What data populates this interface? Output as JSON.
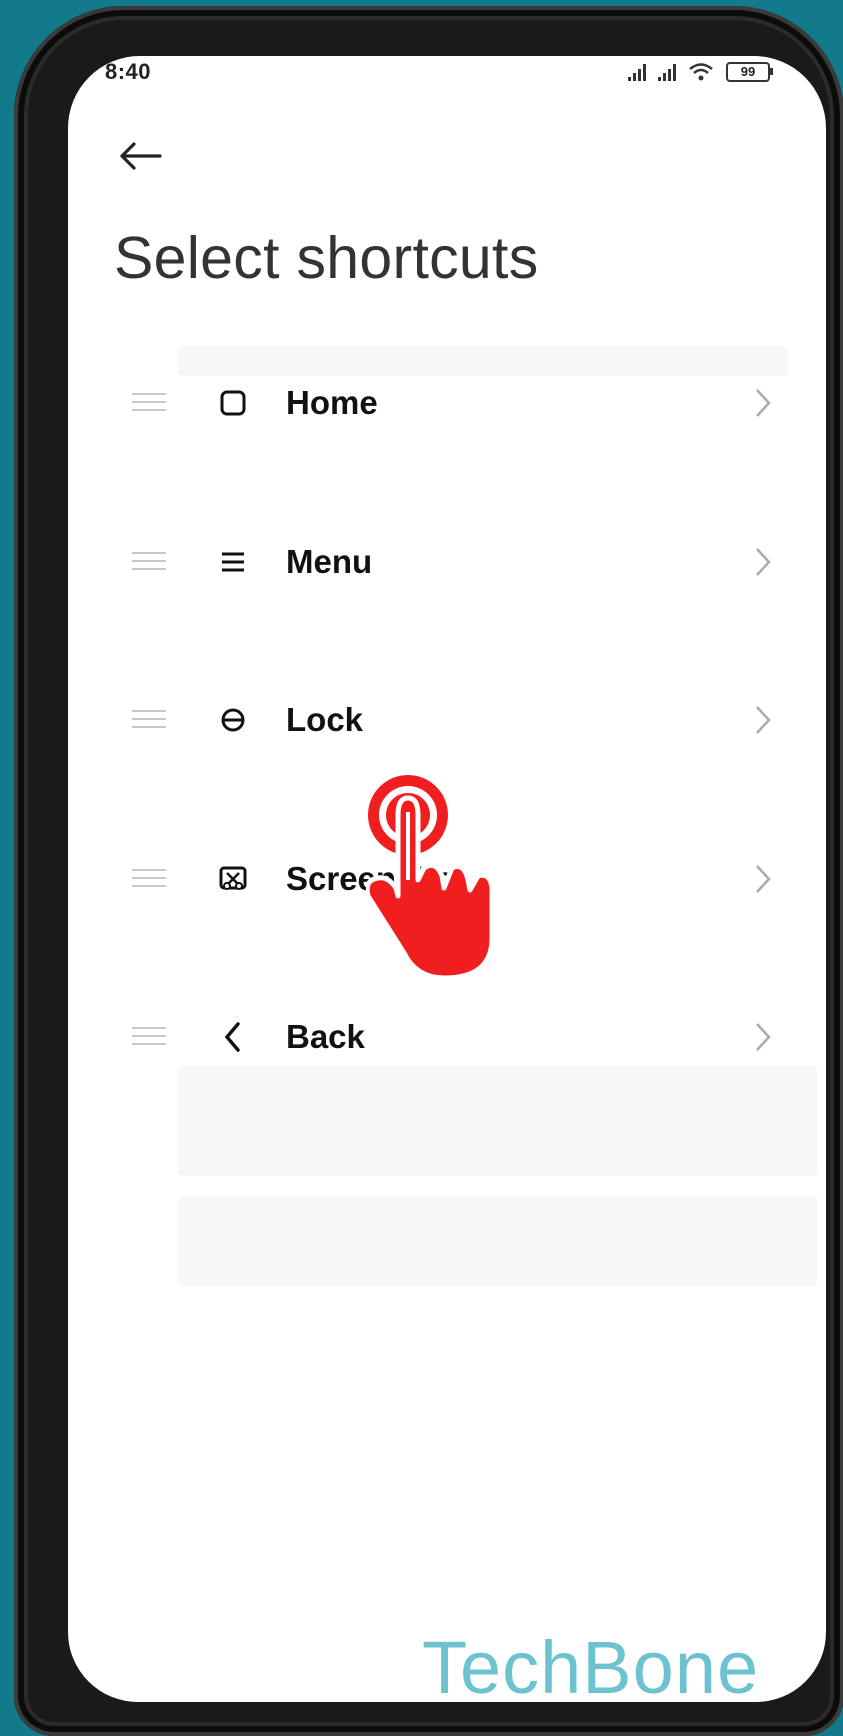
{
  "status_bar": {
    "time": "8:40",
    "battery": "99"
  },
  "header": {
    "title": "Select shortcuts"
  },
  "shortcuts": [
    {
      "label": "Home",
      "icon": "square-icon"
    },
    {
      "label": "Menu",
      "icon": "menu-icon"
    },
    {
      "label": "Lock",
      "icon": "lock-icon"
    },
    {
      "label": "Screenshot",
      "icon": "screenshot-icon"
    },
    {
      "label": "Back",
      "icon": "back-chevron-icon"
    }
  ],
  "overlay": {
    "gesture": "tap-hand-icon",
    "color": "#f01e1e"
  },
  "watermark": "TechBone",
  "colors": {
    "background": "#137a8c",
    "accent": "#f01e1e",
    "watermark": "#6cc3cf"
  }
}
